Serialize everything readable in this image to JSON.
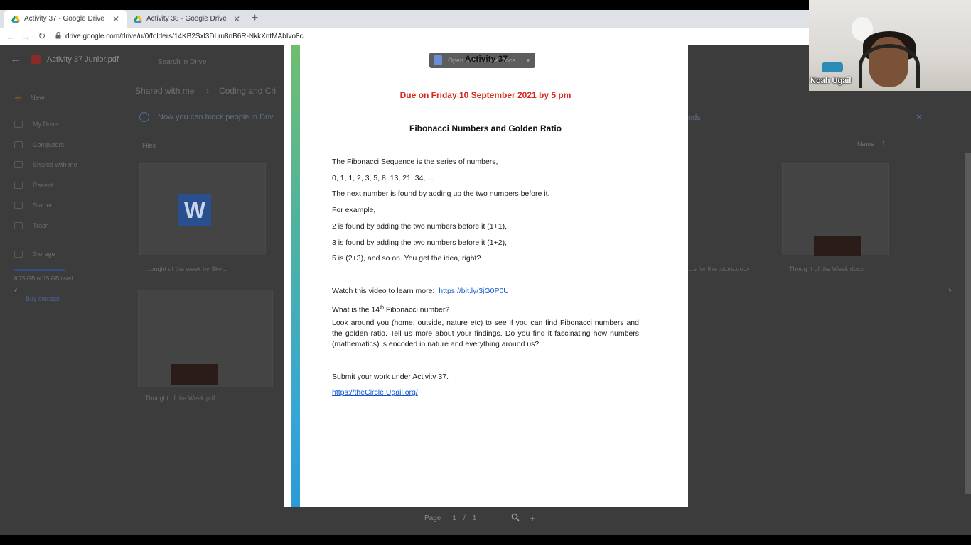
{
  "browser": {
    "tabs": [
      {
        "title": "Activity 37 - Google Drive",
        "active": true
      },
      {
        "title": "Activity 38 - Google Drive",
        "active": false
      }
    ],
    "new_tab": "+",
    "url": "drive.google.com/drive/u/0/folders/14KB2Sxl3DLru8nB6R-NkkXntMAbIvo8c",
    "close_glyph": "✕"
  },
  "drive": {
    "file_title": "Activity 37 Junior.pdf",
    "search_placeholder": "Search in Drive",
    "new_label": "New",
    "breadcrumb": [
      "Shared with me",
      "Coding and Cri"
    ],
    "banner": "Now you can block people in Driv",
    "banner_tail": "nds",
    "files_label": "Files",
    "sort_label": "Name",
    "sidebar": [
      "My Drive",
      "Computers",
      "Shared with me",
      "Recent",
      "Starred",
      "Trash",
      "Storage"
    ],
    "storage_text": "8.75 GB of 15 GB used",
    "buy_storage": "Buy storage",
    "thumb_titles": [
      "...ought of the week by Sky...",
      "...s for the tutors.docx",
      "Thought of the Week.docx",
      "Thought of the Week.pdf"
    ]
  },
  "viewer": {
    "open_with": "Open with Google Docs"
  },
  "document": {
    "heading": "Activity 37",
    "due": "Due on Friday 10 September 2021 by 5 pm",
    "subheading": "Fibonacci Numbers and Golden Ratio",
    "lines": [
      "The Fibonacci Sequence is the series of numbers,",
      "0, 1, 1, 2, 3, 5, 8, 13, 21, 34, ...",
      "The next number is found by adding up the two numbers before it.",
      "For example,",
      "2 is found by adding the two numbers before it (1+1),",
      "3 is found by adding the two numbers before it (1+2),",
      "5 is (2+3), and so on. You get the idea, right?"
    ],
    "video_prefix": "Watch this video to learn more:",
    "video_link": "https://bit.ly/3jG0P0U",
    "question_prefix": "What is the 14",
    "question_sup": "th",
    "question_suffix": " Fibonacci number?",
    "look_paragraph": "Look around you (home, outside, nature etc) to see if you can find Fibonacci numbers and the golden ratio. Tell us more about your findings. Do you find it fascinating how numbers (mathematics) is encoded in nature and everything around us?",
    "submit": "Submit your work under Activity 37.",
    "submit_link": "https://theCircle.Ugail.org/"
  },
  "page_controls": {
    "page_label": "Page",
    "current": "1",
    "separator": "/",
    "total": "1",
    "zoom_out": "—",
    "zoom_icon": "🔍",
    "zoom_in": "+"
  },
  "webcam": {
    "name": "Noah Ugail"
  },
  "icons": {
    "back": "←",
    "forward": "→",
    "reload": "↻",
    "lock": "🔒",
    "prev": "‹",
    "next": "›"
  },
  "colors": {
    "due_red": "#d9261c",
    "link_blue": "#1155cc"
  }
}
